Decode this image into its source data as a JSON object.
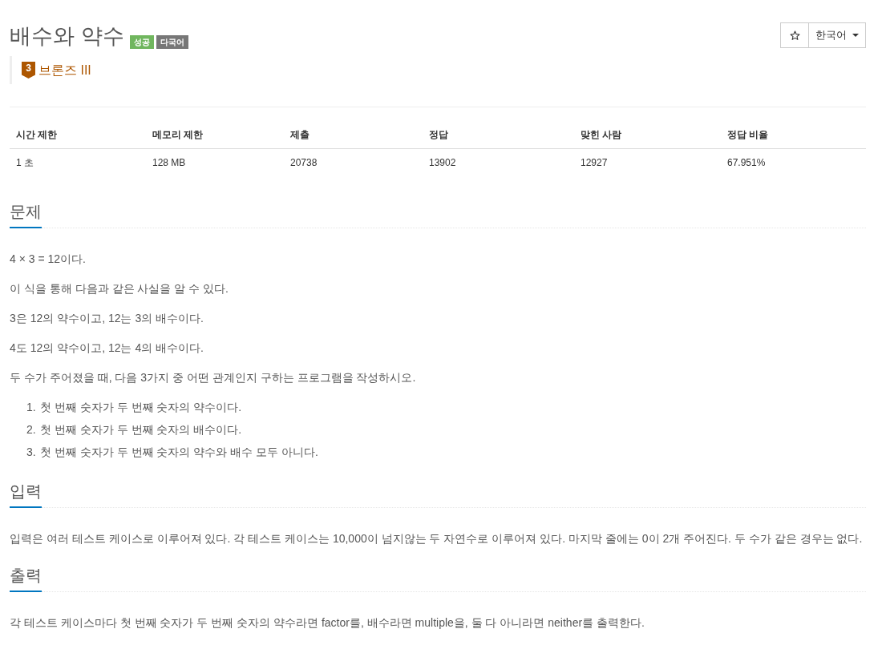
{
  "problem": {
    "title": "배수와 약수",
    "badges": [
      {
        "label": "성공",
        "kind": "success"
      },
      {
        "label": "다국어",
        "kind": "multilang"
      }
    ],
    "tier": {
      "number": "3",
      "label": "브론즈 III"
    }
  },
  "toolbar": {
    "language": "한국어"
  },
  "stats_table": {
    "columns": [
      "시간 제한",
      "메모리 제한",
      "제출",
      "정답",
      "맞힌 사람",
      "정답 비율"
    ],
    "rows": [
      [
        "1 초",
        "128 MB",
        "20738",
        "13902",
        "12927",
        "67.951%"
      ]
    ]
  },
  "sections": [
    {
      "heading": "문제",
      "blocks": [
        {
          "kind": "paragraph",
          "text": "4 × 3 = 12이다."
        },
        {
          "kind": "paragraph",
          "text": "이 식을 통해 다음과 같은 사실을 알 수 있다."
        },
        {
          "kind": "paragraph",
          "text": "3은 12의 약수이고, 12는 3의 배수이다."
        },
        {
          "kind": "paragraph",
          "text": "4도 12의 약수이고, 12는 4의 배수이다."
        },
        {
          "kind": "paragraph",
          "text": "두 수가 주어졌을 때, 다음 3가지 중 어떤 관계인지 구하는 프로그램을 작성하시오."
        },
        {
          "kind": "ordered_list",
          "items": [
            {
              "number": "1.",
              "text": "첫 번째 숫자가 두 번째 숫자의 약수이다."
            },
            {
              "number": "2.",
              "text": "첫 번째 숫자가 두 번째 숫자의 배수이다."
            },
            {
              "number": "3.",
              "text": "첫 번째 숫자가 두 번째 숫자의 약수와 배수 모두 아니다."
            }
          ]
        }
      ]
    },
    {
      "heading": "입력",
      "blocks": [
        {
          "kind": "paragraph",
          "text": "입력은 여러 테스트 케이스로 이루어져 있다. 각 테스트 케이스는 10,000이 넘지않는 두 자연수로 이루어져 있다. 마지막 줄에는 0이 2개 주어진다. 두 수가 같은 경우는 없다."
        }
      ]
    },
    {
      "heading": "출력",
      "blocks": [
        {
          "kind": "paragraph",
          "text": "각 테스트 케이스마다 첫 번째 숫자가 두 번째 숫자의 약수라면 factor를, 배수라면 multiple을, 둘 다 아니라면 neither를 출력한다."
        }
      ]
    }
  ]
}
